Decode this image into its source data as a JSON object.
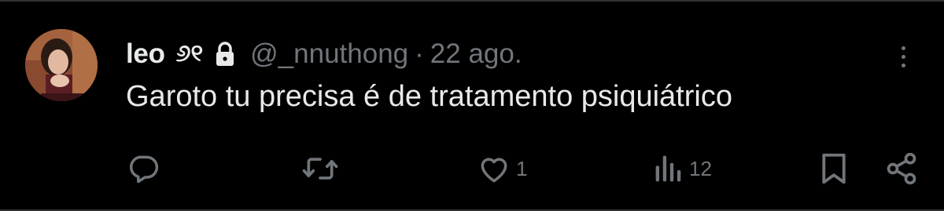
{
  "colors": {
    "background": "#000000",
    "text_primary": "#e7e9ea",
    "text_secondary": "#71767b",
    "border": "#2f3336"
  },
  "author": {
    "display_name": "leo",
    "name_glyph": "୬୧",
    "handle": "@_nnuthong",
    "separator": "·",
    "date": "22 ago.",
    "protected_icon": "lock-icon"
  },
  "tweet": {
    "text": "Garoto tu precisa é de tratamento psiquiátrico"
  },
  "actions": {
    "reply": {
      "icon": "reply-icon",
      "count": ""
    },
    "retweet": {
      "icon": "retweet-icon",
      "count": ""
    },
    "like": {
      "icon": "heart-icon",
      "count": "1"
    },
    "views": {
      "icon": "views-icon",
      "count": "12"
    },
    "bookmark": {
      "icon": "bookmark-icon"
    },
    "share": {
      "icon": "share-icon"
    }
  },
  "menu": {
    "icon": "more-vertical-icon"
  }
}
